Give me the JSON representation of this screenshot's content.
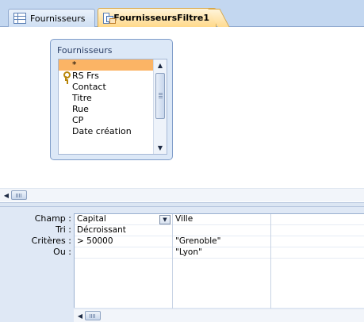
{
  "tabs": [
    {
      "label": "Fournisseurs",
      "icon": "table-icon",
      "active": false
    },
    {
      "label": "FournisseursFiltre1",
      "icon": "query-icon",
      "active": true
    }
  ],
  "field_list": {
    "title": "Fournisseurs",
    "items": [
      {
        "label": "*",
        "selected": true,
        "key": false
      },
      {
        "label": "RS Frs",
        "selected": false,
        "key": true
      },
      {
        "label": "Contact",
        "selected": false,
        "key": false
      },
      {
        "label": "Titre",
        "selected": false,
        "key": false
      },
      {
        "label": "Rue",
        "selected": false,
        "key": false
      },
      {
        "label": "CP",
        "selected": false,
        "key": false
      },
      {
        "label": "Date création",
        "selected": false,
        "key": false
      }
    ]
  },
  "grid": {
    "row_labels": [
      "Champ :",
      "Tri :",
      "Critères :",
      "Ou :"
    ],
    "columns": [
      {
        "cells": [
          "Capital",
          "Décroissant",
          "> 50000",
          ""
        ],
        "has_dropdown": true
      },
      {
        "cells": [
          "Ville",
          "",
          "\"Grenoble\"",
          "\"Lyon\""
        ],
        "has_dropdown": false
      },
      {
        "cells": [
          "",
          "",
          "",
          ""
        ],
        "has_dropdown": false
      }
    ]
  },
  "colors": {
    "active_tab": "#ffd98a",
    "selected_field": "#fbb465",
    "pane_background": "#dfe8f5"
  }
}
